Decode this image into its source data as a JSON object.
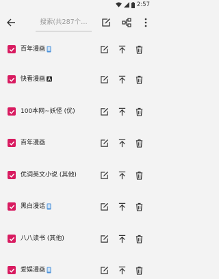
{
  "status_bar": {
    "time": "2:57"
  },
  "toolbar": {
    "search_placeholder": "搜索(共287个…"
  },
  "sources": [
    {
      "label": "百年漫画",
      "badge": "phone-badge-icon",
      "checked": true
    },
    {
      "label": "快看漫画",
      "badge": "a-badge-icon",
      "checked": true
    },
    {
      "label": "100本网~妖怪 (优)",
      "badge": null,
      "checked": true
    },
    {
      "label": "百年漫画",
      "badge": null,
      "checked": true
    },
    {
      "label": "优词英文小说 (其他)",
      "badge": null,
      "checked": true
    },
    {
      "label": "黑白漫话",
      "badge": "phone-badge-icon",
      "checked": true
    },
    {
      "label": "八八读书 (其他)",
      "badge": null,
      "checked": true
    },
    {
      "label": "爱娱漫画",
      "badge": "phone-badge-icon",
      "checked": true
    }
  ],
  "colors": {
    "accent": "#d81b60",
    "background": "#f3f3f3",
    "icon": "#333333"
  }
}
